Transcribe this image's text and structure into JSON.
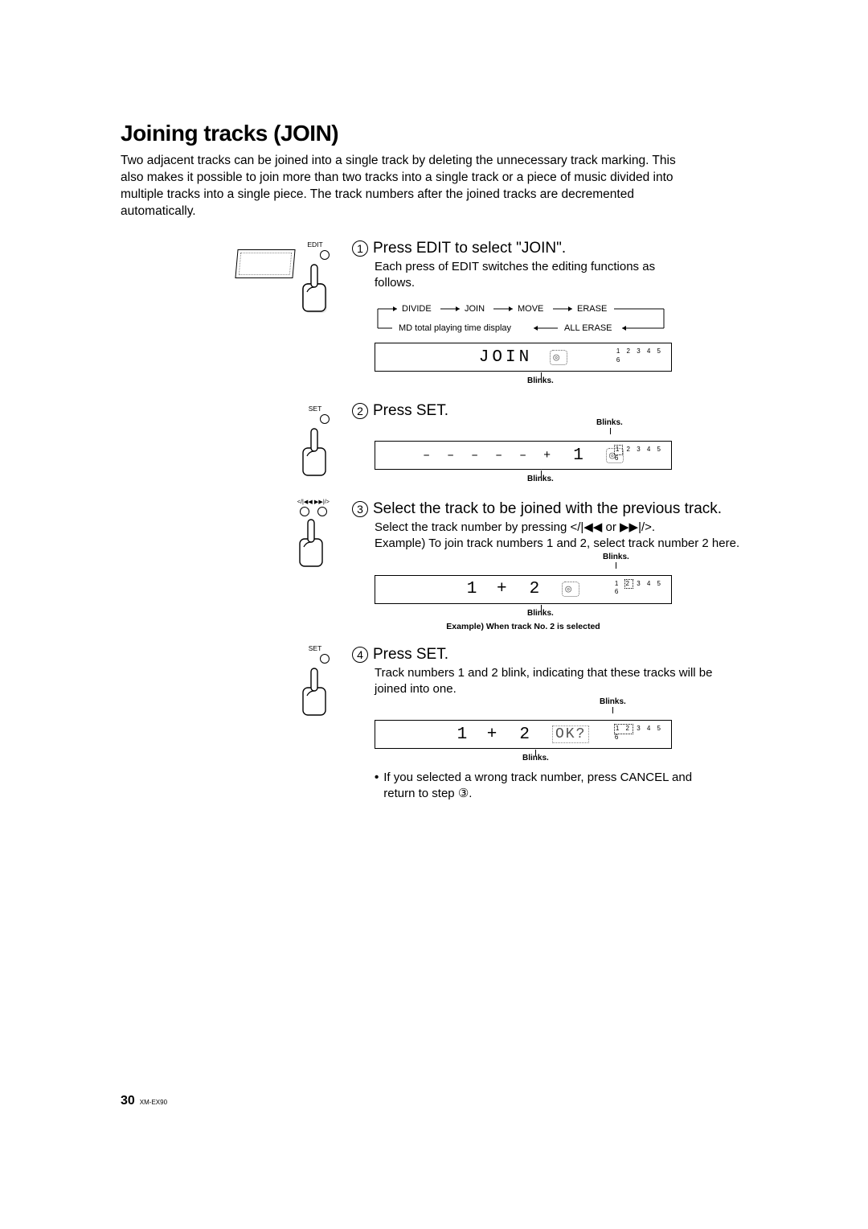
{
  "title": "Joining tracks (JOIN)",
  "intro": "Two adjacent tracks can be joined into a single track by deleting the unnecessary track marking. This also makes it possible to join more than two tracks into a single track or a piece of music divided into multiple tracks into a single piece. The track numbers after the joined tracks are decremented automatically.",
  "left": {
    "edit_label": "EDIT",
    "set_label": "SET",
    "prevnext_label": "</|◀◀    ▶▶|/>"
  },
  "steps": {
    "s1": {
      "num": "1",
      "heading": "Press EDIT to select \"JOIN\".",
      "body": "Each press of EDIT switches the editing functions as follows."
    },
    "s2": {
      "num": "2",
      "heading": "Press SET."
    },
    "s3": {
      "num": "3",
      "heading": "Select the track to be joined with the previous track.",
      "body": "Select the track number by pressing </|◀◀ or ▶▶|/>.\nExample) To join track numbers 1 and 2, select track number 2 here."
    },
    "s4": {
      "num": "4",
      "heading": "Press SET.",
      "body": "Track numbers 1 and 2 blink, indicating that these tracks will be joined into one.",
      "bullet": "If you selected a wrong track number, press CANCEL and return to step ③."
    }
  },
  "flow": {
    "items_top": [
      "DIVIDE",
      "JOIN",
      "MOVE",
      "ERASE"
    ],
    "items_bottom_left": "MD total playing time display",
    "items_bottom_right": "ALL ERASE"
  },
  "lcd": {
    "l1_center": "JOIN",
    "l1_disc": "◎",
    "l1_tracks_top": "1 2 3 4 5",
    "l1_tracks_bot": "6",
    "blinks_label": "Blinks.",
    "l2_left": "– – – – – + ",
    "l2_num": "1",
    "l2_tracks_top": "  2 3 4 5",
    "l2_tracks_bot": "6",
    "l3_left": "1 + ",
    "l3_right": "2",
    "l3_tracks_top_a": "1",
    "l3_tracks_top_b": "2",
    "l3_tracks_top_c": "3 4 5",
    "l3_tracks_bot": "6",
    "example_caption": "Example) When track No. 2 is selected",
    "l4_left": "1 + ",
    "l4_right": "2",
    "l4_ok": "OK?",
    "l4_tracks_top_a": "1 2",
    "l4_tracks_top_b": "3 4 5",
    "l4_tracks_bot": "6"
  },
  "footer": {
    "page_num": "30",
    "model": "XM-EX90"
  }
}
